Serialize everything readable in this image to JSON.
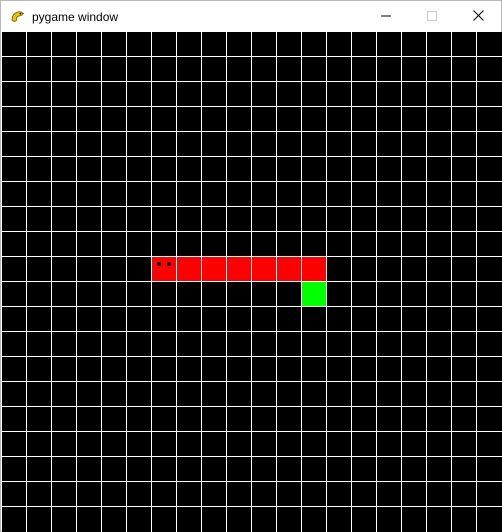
{
  "window": {
    "title": "pygame window",
    "icon": "pygame-snake-icon"
  },
  "controls": {
    "minimize_icon": "minimize-icon",
    "maximize_icon": "maximize-icon",
    "close_icon": "close-icon"
  },
  "game": {
    "grid_rows": 20,
    "grid_cols": 20,
    "background_color": "#000000",
    "grid_color": "#ffffff",
    "snake_color": "#ff0000",
    "food_color": "#00ff00",
    "snake": [
      {
        "row": 9,
        "col": 6
      },
      {
        "row": 9,
        "col": 7
      },
      {
        "row": 9,
        "col": 8
      },
      {
        "row": 9,
        "col": 9
      },
      {
        "row": 9,
        "col": 10
      },
      {
        "row": 9,
        "col": 11
      },
      {
        "row": 9,
        "col": 12
      }
    ],
    "food": {
      "row": 10,
      "col": 12
    }
  }
}
